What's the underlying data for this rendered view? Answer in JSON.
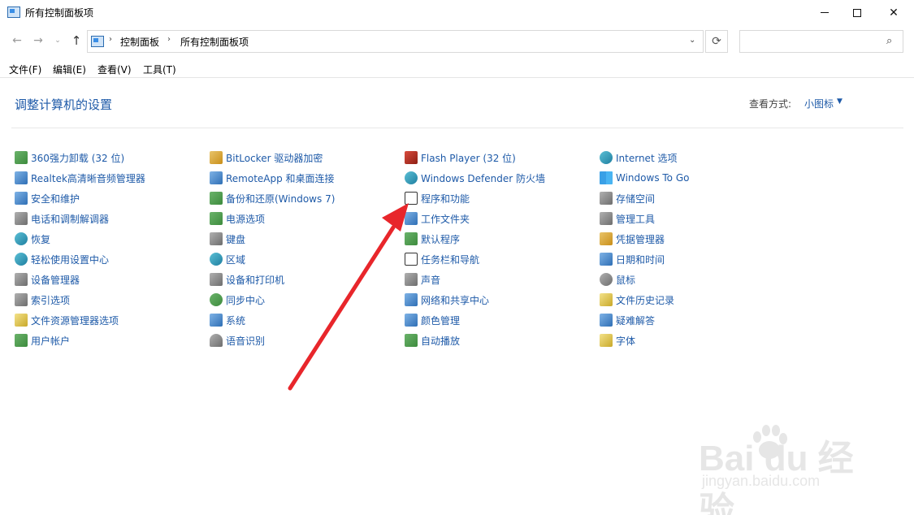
{
  "window": {
    "title": "所有控制面板项",
    "minimize": "—",
    "maximize": "",
    "close": "✕"
  },
  "nav": {
    "back": "←",
    "forward": "→",
    "recent": "⌄",
    "up": "↑",
    "refresh": "⟳",
    "breadcrumb": [
      "控制面板",
      "所有控制面板项"
    ],
    "crumb_sep": "›",
    "address_dropdown": "⌄",
    "search_placeholder": "",
    "search_icon": "⌕"
  },
  "menu": [
    "文件(F)",
    "编辑(E)",
    "查看(V)",
    "工具(T)"
  ],
  "main": {
    "heading": "调整计算机的设置",
    "view_by_label": "查看方式:",
    "view_by_value": "小图标",
    "view_by_caret": "▼"
  },
  "columns": [
    [
      {
        "label": "360强力卸载 (32 位)",
        "icon": "uninstall-icon"
      },
      {
        "label": "Realtek高清晰音频管理器",
        "icon": "audio-manager-icon"
      },
      {
        "label": "安全和维护",
        "icon": "flag-icon"
      },
      {
        "label": "电话和调制解调器",
        "icon": "phone-modem-icon"
      },
      {
        "label": "恢复",
        "icon": "recovery-icon"
      },
      {
        "label": "轻松使用设置中心",
        "icon": "ease-of-access-icon"
      },
      {
        "label": "设备管理器",
        "icon": "device-manager-icon"
      },
      {
        "label": "索引选项",
        "icon": "indexing-icon"
      },
      {
        "label": "文件资源管理器选项",
        "icon": "folder-options-icon"
      },
      {
        "label": "用户帐户",
        "icon": "user-accounts-icon"
      }
    ],
    [
      {
        "label": "BitLocker 驱动器加密",
        "icon": "bitlocker-icon"
      },
      {
        "label": "RemoteApp 和桌面连接",
        "icon": "remoteapp-icon"
      },
      {
        "label": "备份和还原(Windows 7)",
        "icon": "backup-icon"
      },
      {
        "label": "电源选项",
        "icon": "power-icon"
      },
      {
        "label": "键盘",
        "icon": "keyboard-icon"
      },
      {
        "label": "区域",
        "icon": "region-icon"
      },
      {
        "label": "设备和打印机",
        "icon": "printer-icon"
      },
      {
        "label": "同步中心",
        "icon": "sync-icon"
      },
      {
        "label": "系统",
        "icon": "system-icon"
      },
      {
        "label": "语音识别",
        "icon": "microphone-icon"
      }
    ],
    [
      {
        "label": "Flash Player (32 位)",
        "icon": "flash-icon"
      },
      {
        "label": "Windows Defender 防火墙",
        "icon": "firewall-icon"
      },
      {
        "label": "程序和功能",
        "icon": "programs-icon"
      },
      {
        "label": "工作文件夹",
        "icon": "work-folders-icon"
      },
      {
        "label": "默认程序",
        "icon": "default-programs-icon"
      },
      {
        "label": "任务栏和导航",
        "icon": "taskbar-icon"
      },
      {
        "label": "声音",
        "icon": "speaker-icon"
      },
      {
        "label": "网络和共享中心",
        "icon": "network-icon"
      },
      {
        "label": "颜色管理",
        "icon": "color-management-icon"
      },
      {
        "label": "自动播放",
        "icon": "autoplay-icon"
      }
    ],
    [
      {
        "label": "Internet 选项",
        "icon": "internet-options-icon"
      },
      {
        "label": "Windows To Go",
        "icon": "windows-to-go-icon"
      },
      {
        "label": "存储空间",
        "icon": "storage-icon"
      },
      {
        "label": "管理工具",
        "icon": "admin-tools-icon"
      },
      {
        "label": "凭据管理器",
        "icon": "credential-icon"
      },
      {
        "label": "日期和时间",
        "icon": "clock-icon"
      },
      {
        "label": "鼠标",
        "icon": "mouse-icon"
      },
      {
        "label": "文件历史记录",
        "icon": "file-history-icon"
      },
      {
        "label": "疑难解答",
        "icon": "troubleshoot-icon"
      },
      {
        "label": "字体",
        "icon": "fonts-icon"
      }
    ]
  ],
  "watermark": {
    "brand": "Bai  du 经验",
    "url": "jingyan.baidu.com"
  },
  "colors": {
    "link": "#1e5aa8",
    "arrow": "#e8262b"
  }
}
